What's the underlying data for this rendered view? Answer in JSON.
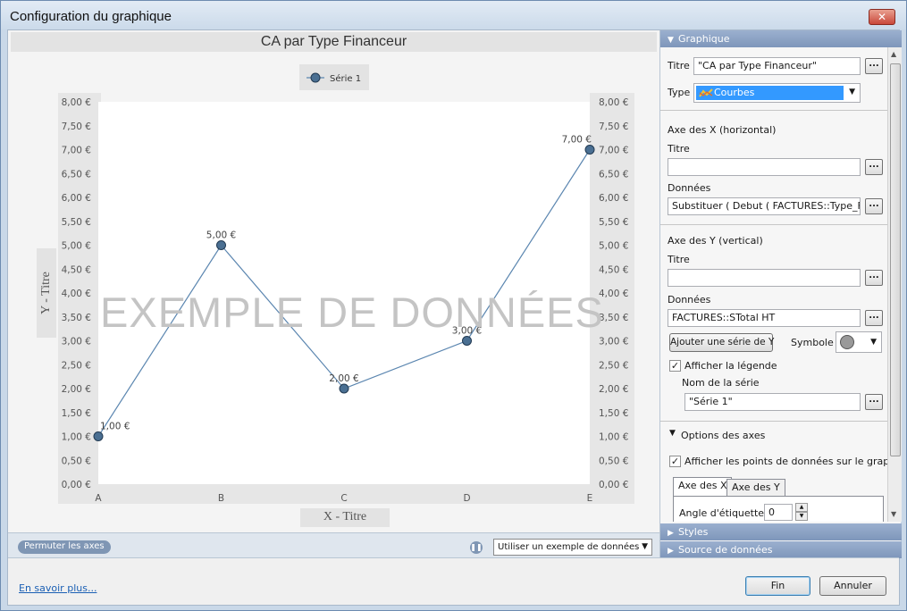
{
  "window": {
    "title": "Configuration du graphique",
    "close_label": "✕"
  },
  "chart_data": {
    "type": "line",
    "title": "CA par Type Financeur",
    "categories": [
      "A",
      "B",
      "C",
      "D",
      "E"
    ],
    "series": [
      {
        "name": "Série 1",
        "values": [
          1,
          5,
          2,
          3,
          7
        ]
      }
    ],
    "data_labels": [
      "1,00 €",
      "5,00 €",
      "2,00 €",
      "3,00 €",
      "7,00 €"
    ],
    "y_ticks": [
      "0,00 €",
      "0,50 €",
      "1,00 €",
      "1,50 €",
      "2,00 €",
      "2,50 €",
      "3,00 €",
      "3,50 €",
      "4,00 €",
      "4,50 €",
      "5,00 €",
      "5,50 €",
      "6,00 €",
      "6,50 €",
      "7,00 €",
      "7,50 €",
      "8,00 €"
    ],
    "ylim": [
      0,
      8
    ],
    "xlabel": "X - Titre",
    "ylabel": "Y - Titre",
    "legend_position": "top-center",
    "grid": false,
    "line_color": "#5b86b0",
    "marker_color": "#4a6f92",
    "watermark": "EXEMPLE DE DONNÉES"
  },
  "chart_toolbar": {
    "swap_axes_label": "Permuter les axes",
    "sample_select_value": "Utiliser un exemple de données"
  },
  "footer": {
    "learn_more": "En savoir plus...",
    "fin_label": "Fin",
    "cancel_label": "Annuler"
  },
  "panel": {
    "graphique_header": "Graphique",
    "titre_label": "Titre",
    "titre_value": "\"CA par Type Financeur\"",
    "type_label": "Type",
    "type_value": "Courbes",
    "axe_x_header": "Axe des X (horizontal)",
    "axe_x_titre_label": "Titre",
    "axe_x_titre_value": "",
    "axe_x_donnees_label": "Données",
    "axe_x_donnees_value": "Substituer ( Debut ( FACTURES::Type_Fina",
    "axe_y_header": "Axe des Y (vertical)",
    "axe_y_titre_label": "Titre",
    "axe_y_titre_value": "",
    "axe_y_donnees_label": "Données",
    "axe_y_donnees_value": "FACTURES::STotal HT",
    "add_series_label": "Ajouter une série de Y",
    "symbole_label": "Symbole",
    "show_legend_label": "Afficher la légende",
    "show_legend_checked": true,
    "series_name_label": "Nom de la série",
    "series_name_value": "\"Série 1\"",
    "axes_options_label": "Options des axes",
    "show_points_label": "Afficher les points de données sur le graphique",
    "show_points_checked": true,
    "tabs": [
      "Axe des X",
      "Axe des Y"
    ],
    "angle_label": "Angle d'étiquette :",
    "angle_value": "0",
    "dots_label": "...",
    "styles_header": "Styles",
    "source_header": "Source de données"
  }
}
